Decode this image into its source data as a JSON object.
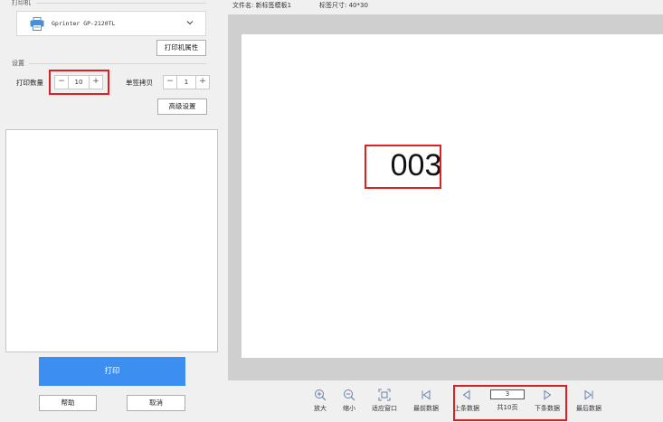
{
  "printer_section": {
    "label": "打印机",
    "selected_printer": "Gprinter  GP-2120TL",
    "properties_button": "打印机属性"
  },
  "settings_section": {
    "label": "设置",
    "print_quantity": {
      "label": "打印数量",
      "value": "10",
      "minus": "−",
      "plus": "+"
    },
    "single_copies": {
      "label": "单签拷贝",
      "value": "1",
      "minus": "−",
      "plus": "+"
    },
    "advanced_button": "高级设置"
  },
  "actions": {
    "print": "打印",
    "help": "帮助",
    "cancel": "取消"
  },
  "preview_info": {
    "file_name": "文件名: 新标签模板1",
    "label_size": "标签尺寸: 40*30"
  },
  "label_content": {
    "text": "003"
  },
  "toolbar": {
    "zoom_in": "放大",
    "zoom_out": "缩小",
    "fit_window": "适应窗口",
    "first": "最前数据",
    "prev": "上条数据",
    "page_current": "3",
    "page_total": "共10页",
    "next": "下条数据",
    "last": "最后数据"
  },
  "colors": {
    "primary_button": "#3c8ff0",
    "highlight": "#e02020",
    "canvas_bg": "#cfcfcf"
  },
  "icons": {
    "printer": "printer-icon",
    "dropdown": "chevron-down-icon",
    "zoom_in": "zoom-in-icon",
    "zoom_out": "zoom-out-icon",
    "fit": "fit-window-icon",
    "first": "first-icon",
    "prev": "previous-icon",
    "next": "next-icon",
    "last": "last-icon"
  }
}
